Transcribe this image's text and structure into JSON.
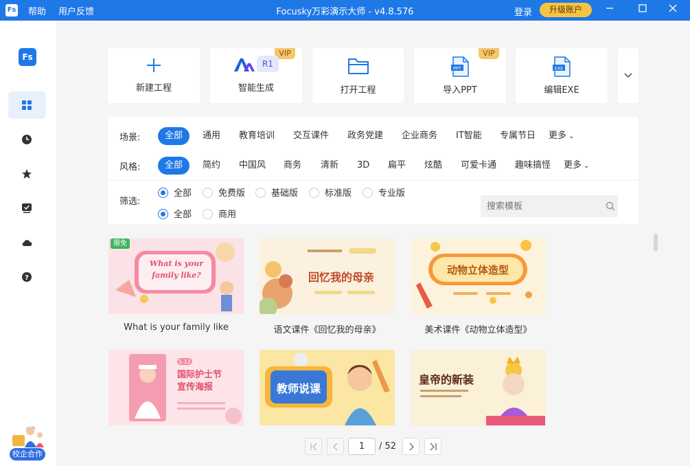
{
  "titlebar": {
    "logo": "Fs",
    "menu": [
      "帮助",
      "用户反馈"
    ],
    "title": "Focusky万彩演示大师 - v4.8.576",
    "login": "登录",
    "upgrade": "升级账户"
  },
  "sidebar": {
    "logo": "Fs",
    "items": [
      {
        "icon": "grid-icon",
        "active": true
      },
      {
        "icon": "clock-icon",
        "active": false
      },
      {
        "icon": "star-icon",
        "active": false
      },
      {
        "icon": "checkbox-icon",
        "active": false
      },
      {
        "icon": "cloud-icon",
        "active": false
      },
      {
        "icon": "help-icon",
        "active": false
      }
    ],
    "promo_label": "校企合作"
  },
  "actions": [
    {
      "label": "新建工程",
      "icon": "plus-icon"
    },
    {
      "label": "智能生成",
      "icon": "ai-icon",
      "vip": "VIP",
      "badge": "R1"
    },
    {
      "label": "打开工程",
      "icon": "folder-icon"
    },
    {
      "label": "导入PPT",
      "icon": "ppt-file-icon",
      "vip": "VIP",
      "file_tag": "PPT"
    },
    {
      "label": "编辑EXE",
      "icon": "exe-file-icon",
      "file_tag": "EXE"
    }
  ],
  "filters": {
    "scene_label": "场景:",
    "scenes": [
      "全部",
      "通用",
      "教育培训",
      "交互课件",
      "政务党建",
      "企业商务",
      "IT智能",
      "专属节日",
      "更多"
    ],
    "style_label": "风格:",
    "styles": [
      "全部",
      "简约",
      "中国风",
      "商务",
      "清新",
      "3D",
      "扁平",
      "炫酷",
      "可爱卡通",
      "趣味搞怪",
      "更多"
    ],
    "screen_label": "筛选:",
    "editions": [
      "全部",
      "免费版",
      "基础版",
      "标准版",
      "专业版"
    ],
    "licenses": [
      "全部",
      "商用"
    ],
    "search_placeholder": "搜索模板"
  },
  "templates": [
    {
      "caption": "What is your family like",
      "thumb_text": "What is your family like?",
      "tag": "限免"
    },
    {
      "caption": "语文课件《回忆我的母亲》",
      "thumb_text": "回忆我的母亲"
    },
    {
      "caption": "美术课件《动物立体造型》",
      "thumb_text": "动物立体造型"
    },
    {
      "caption": "",
      "thumb_text": "国际护士节宣传海报",
      "thumb_sub": "5.12"
    },
    {
      "caption": "",
      "thumb_text": "教师说课"
    },
    {
      "caption": "",
      "thumb_text": "皇帝的新装"
    }
  ],
  "pagination": {
    "current": "1",
    "total": "/ 52"
  },
  "colors": {
    "accent": "#1e78e6",
    "vip": "#f6c66b",
    "upgrade": "#f5c344"
  }
}
